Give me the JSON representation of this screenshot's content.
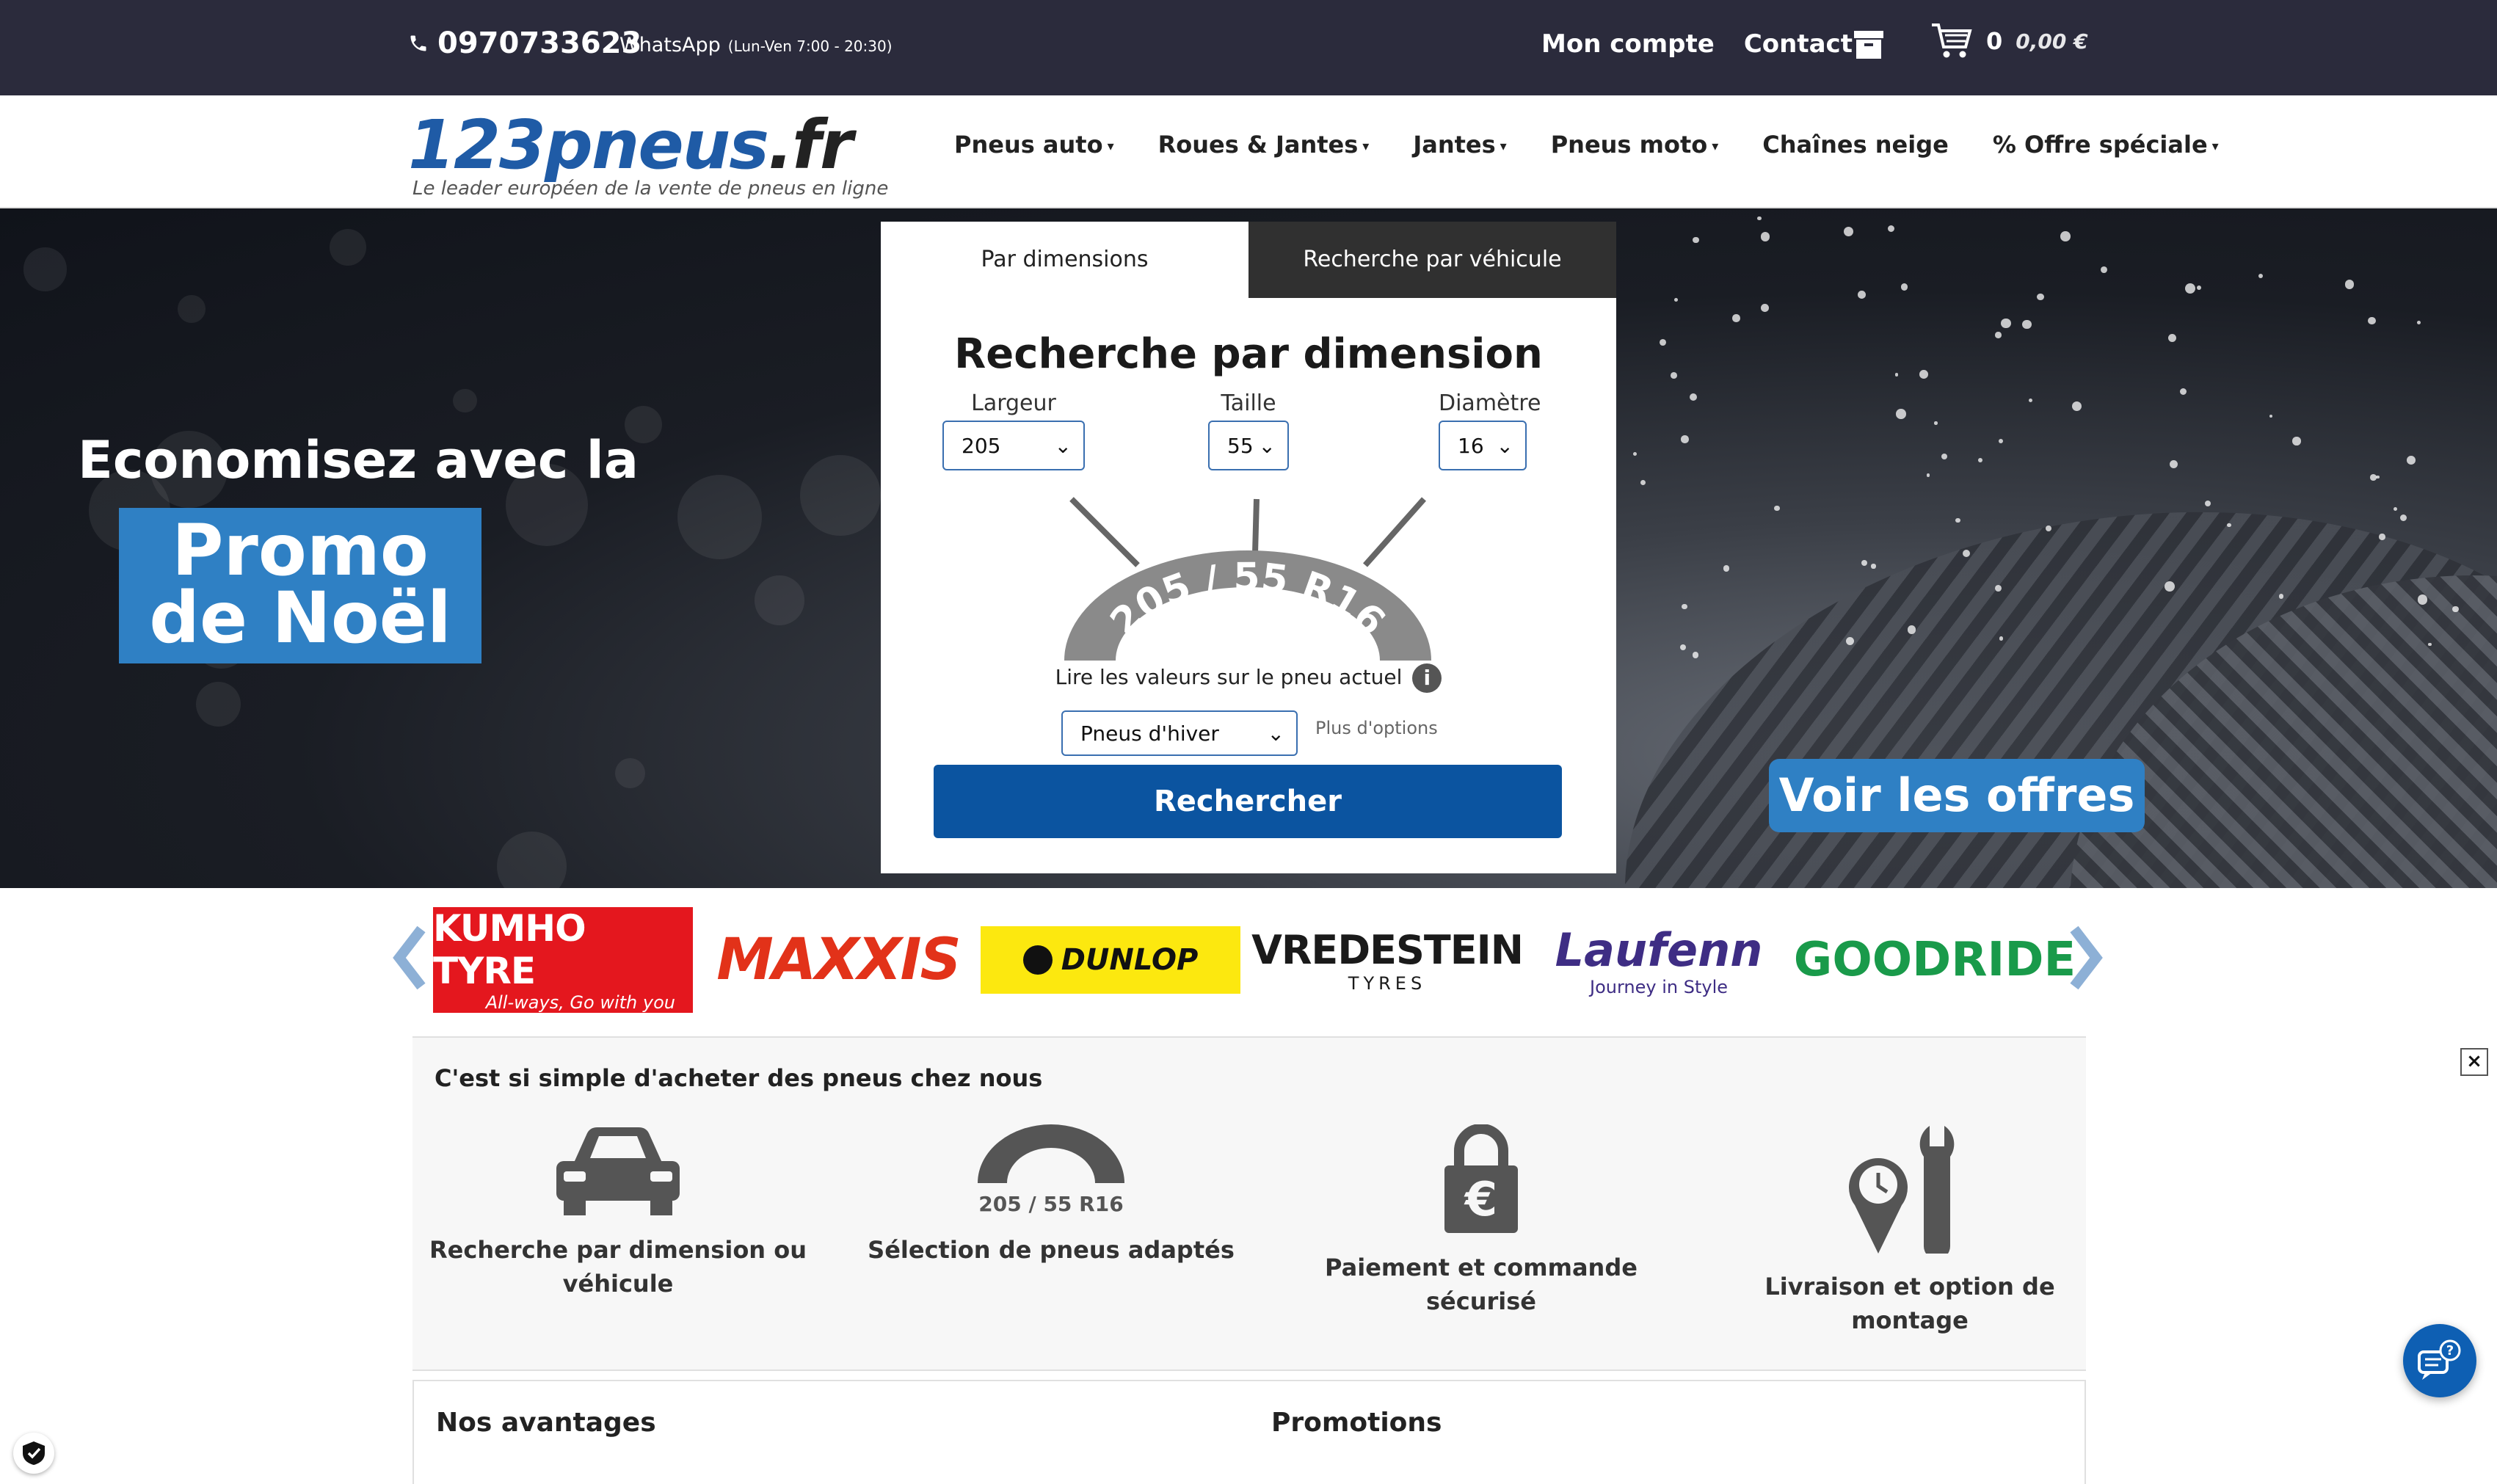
{
  "topbar": {
    "phone": "0970733623",
    "whatsapp": "WhatsApp",
    "hours": "(Lun-Ven 7:00 - 20:30)",
    "account": "Mon compte",
    "contact": "Contact",
    "cart_count": "0",
    "cart_total": "0,00 €"
  },
  "header": {
    "logo_main": "123pneus",
    "logo_tld": ".fr",
    "tagline": "Le leader européen de la vente de pneus en ligne",
    "nav": [
      {
        "label": "Pneus auto",
        "dropdown": true
      },
      {
        "label": "Roues & Jantes",
        "dropdown": true
      },
      {
        "label": "Jantes",
        "dropdown": true
      },
      {
        "label": "Pneus moto",
        "dropdown": true
      },
      {
        "label": "Chaînes neige",
        "dropdown": false
      },
      {
        "label": "% Offre spéciale",
        "dropdown": true
      }
    ]
  },
  "hero": {
    "promo_intro": "Economisez avec la",
    "promo_line1": "Promo",
    "promo_line2": "de Noël",
    "offers_button": "Voir les offres"
  },
  "search": {
    "tab_dimensions": "Par dimensions",
    "tab_vehicle": "Recherche par véhicule",
    "title": "Recherche par dimension",
    "width_label": "Largeur",
    "width_value": "205",
    "height_label": "Taille",
    "height_value": "55",
    "diameter_label": "Diamètre",
    "diameter_value": "16",
    "tyre_marking": "205 / 55 R16",
    "read_values": "Lire les valeurs sur le pneu actuel",
    "season_value": "Pneus d'hiver",
    "more_options": "Plus d'options",
    "search_button": "Rechercher"
  },
  "brands": {
    "kumho_name": "KUMHO TYRE",
    "kumho_slogan": "All-ways, Go with you",
    "maxxis": "MAXXIS",
    "dunlop": "DUNLOP",
    "vredestein_name": "VREDESTEIN",
    "vredestein_sub": "TYRES",
    "laufenn_name": "Laufenn",
    "laufenn_sub": "Journey in Style",
    "goodride": "GOODRIDE"
  },
  "steps": {
    "title": "C'est si simple d'acheter des pneus chez nous",
    "items": [
      {
        "label": "Recherche par dimension ou véhicule",
        "icon": "car-icon"
      },
      {
        "label": "Sélection de pneus adaptés",
        "icon": "tyre-icon",
        "marking": "205 / 55 R16"
      },
      {
        "label": "Paiement et commande sécurisé",
        "icon": "padlock-euro-icon"
      },
      {
        "label": "Livraison et option de montage",
        "icon": "delivery-wrench-icon"
      }
    ]
  },
  "bottom": {
    "advantages": "Nos avantages",
    "promotions": "Promotions"
  },
  "colors": {
    "topbar_bg": "#2b2b3c",
    "brand_blue": "#0b54a0",
    "promo_blue": "#2f80c4"
  }
}
